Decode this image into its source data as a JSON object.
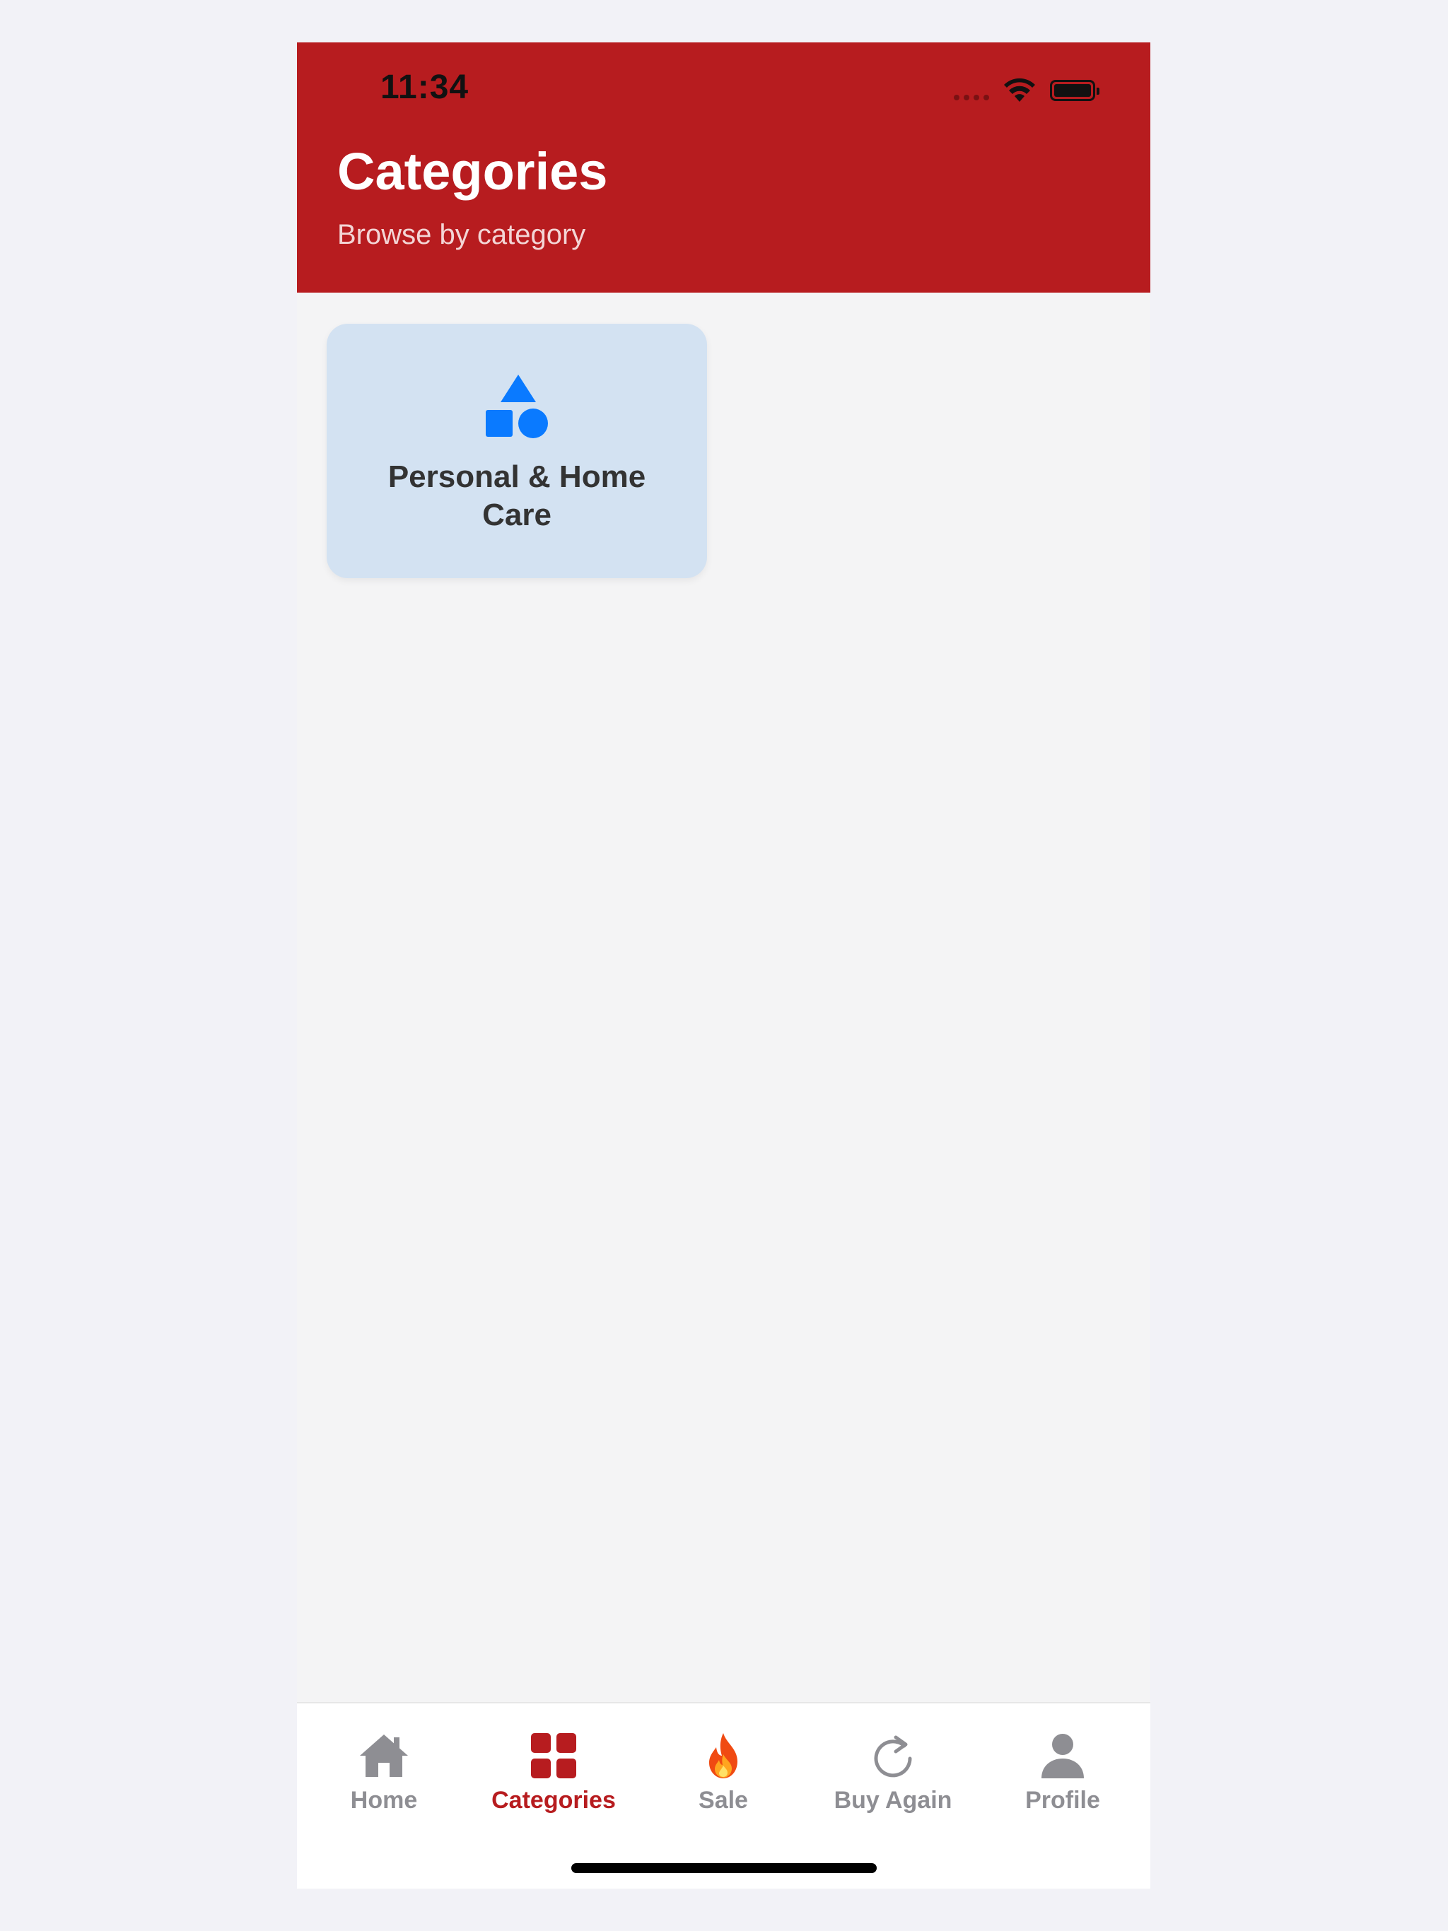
{
  "status_bar": {
    "time": "11:34"
  },
  "header": {
    "title": "Categories",
    "subtitle": "Browse by category",
    "background_color": "#b71c1f"
  },
  "categories": [
    {
      "label": "Personal & Home Care",
      "icon": "shapes-icon",
      "icon_color": "#0a7aff",
      "background_color": "#d3e2f2"
    }
  ],
  "tab_bar": {
    "active_tab": "Categories",
    "active_color": "#b71c1f",
    "inactive_color": "#8e8e93",
    "tabs": [
      {
        "label": "Home",
        "icon": "house-icon"
      },
      {
        "label": "Categories",
        "icon": "grid-icon"
      },
      {
        "label": "Sale",
        "icon": "fire-icon"
      },
      {
        "label": "Buy Again",
        "icon": "refresh-icon"
      },
      {
        "label": "Profile",
        "icon": "person-icon"
      }
    ]
  }
}
